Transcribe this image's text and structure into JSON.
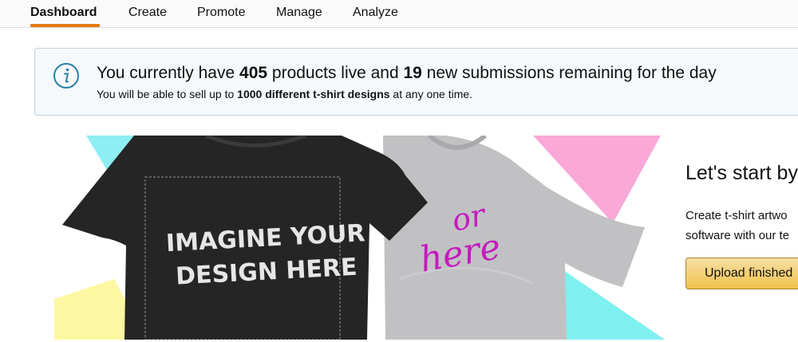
{
  "nav": {
    "tabs": [
      {
        "label": "Dashboard"
      },
      {
        "label": "Create"
      },
      {
        "label": "Promote"
      },
      {
        "label": "Manage"
      },
      {
        "label": "Analyze"
      }
    ],
    "active_tab": "Dashboard",
    "accent_color": "#e47911"
  },
  "alert": {
    "icon": "info-icon",
    "line1_prefix": "You currently have ",
    "products_live": "405",
    "line1_mid": " products live and ",
    "submissions_remaining": "19",
    "line1_suffix": " new submissions remaining for the day",
    "line2_prefix": "You will be able to sell up to ",
    "line2_bold": "1000 different t-shirt designs",
    "line2_suffix": " at any one time."
  },
  "banner": {
    "black_shirt_text_line1": "IMAGINE YOUR",
    "black_shirt_text_line2": "DESIGN HERE",
    "grey_shirt_text_line1": "or",
    "grey_shirt_text_line2": "here",
    "title": "Let's start by",
    "description_line1": "Create t-shirt artwo",
    "description_line2": "software with our te",
    "upload_button_label": "Upload finished"
  }
}
